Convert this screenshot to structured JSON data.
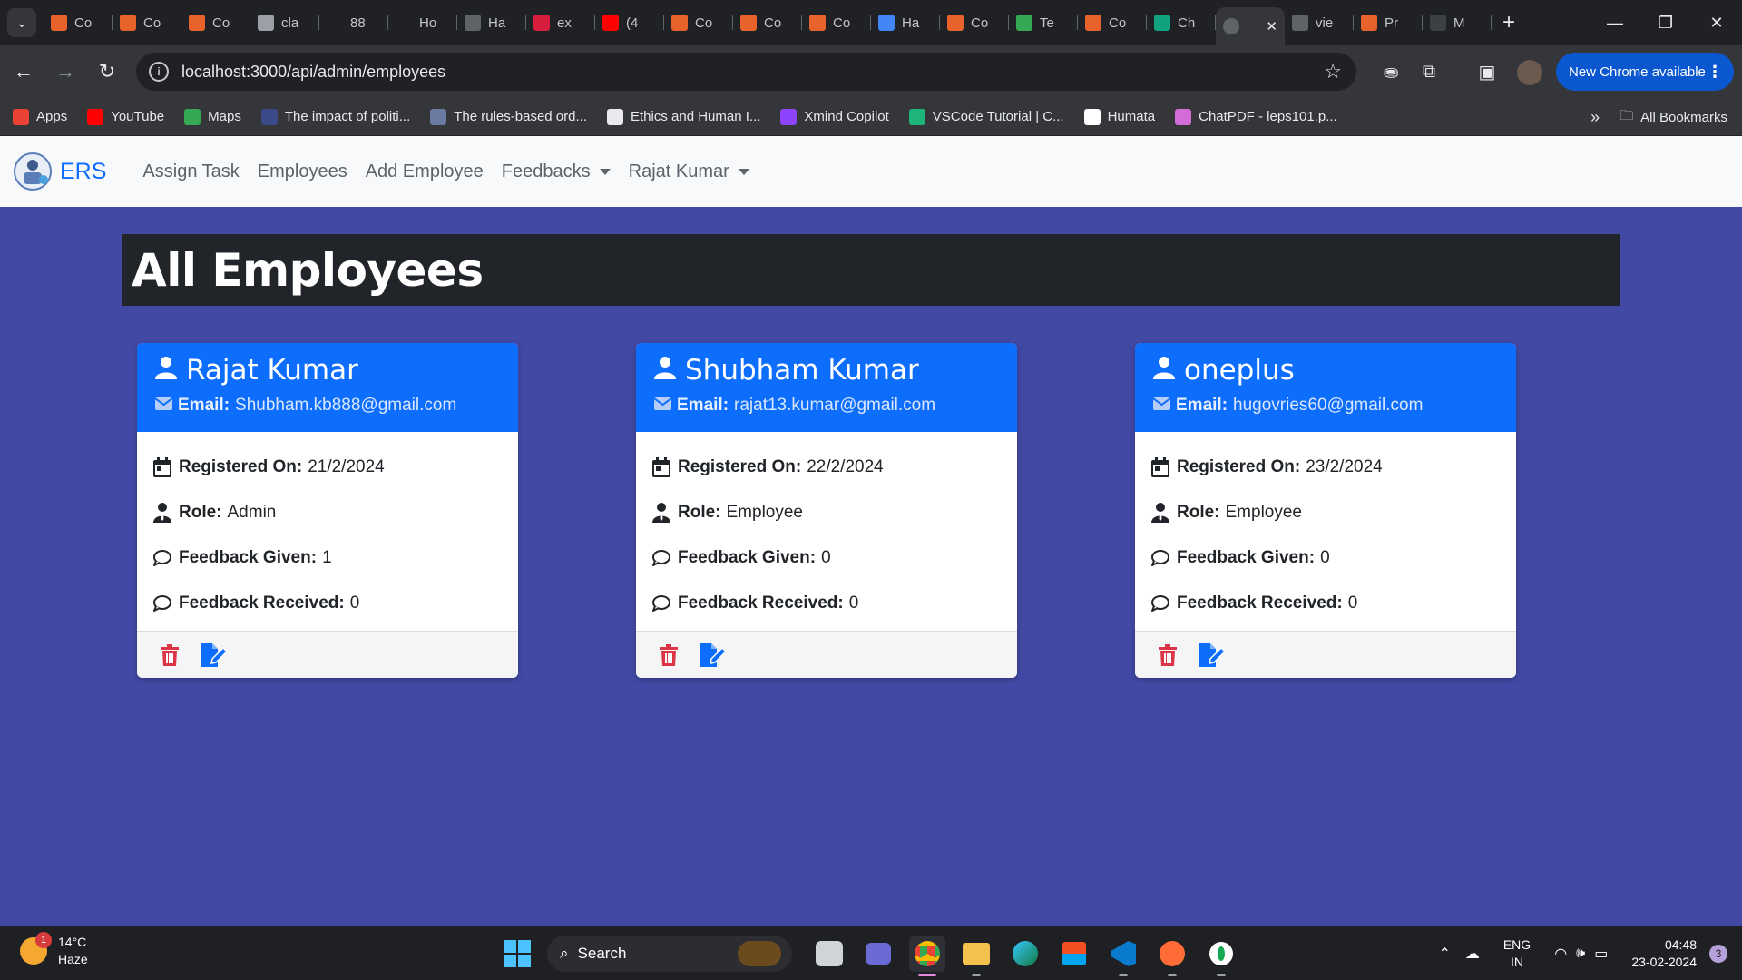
{
  "browser": {
    "tabs": [
      {
        "title": "Co",
        "color": "#e8632b"
      },
      {
        "title": "Co",
        "color": "#e8632b"
      },
      {
        "title": "Co",
        "color": "#e8632b"
      },
      {
        "title": "cla",
        "color": "#9aa0a6"
      },
      {
        "title": "88",
        "color": "#202124"
      },
      {
        "title": "Ho",
        "color": "#202124"
      },
      {
        "title": "Ha",
        "color": "#5f6368"
      },
      {
        "title": "ex",
        "color": "#d61e3c"
      },
      {
        "title": "(4",
        "color": "#ff0000"
      },
      {
        "title": "Co",
        "color": "#e8632b"
      },
      {
        "title": "Co",
        "color": "#e8632b"
      },
      {
        "title": "Co",
        "color": "#e8632b"
      },
      {
        "title": "Ha",
        "color": "#4285f4"
      },
      {
        "title": "Co",
        "color": "#e8632b"
      },
      {
        "title": "Te",
        "color": "#34a853"
      },
      {
        "title": "Co",
        "color": "#e8632b"
      },
      {
        "title": "Ch",
        "color": "#10a37f"
      }
    ],
    "active_tab": {
      "title": ""
    },
    "tabs_after": [
      {
        "title": "vie",
        "color": "#5f6368"
      },
      {
        "title": "Pr",
        "color": "#e8632b"
      },
      {
        "title": "M",
        "color": "#3c4043"
      }
    ],
    "url": "localhost:3000/api/admin/employees",
    "update_label": "New Chrome available",
    "bookmarks": [
      {
        "label": "Apps",
        "color": "#ea4335"
      },
      {
        "label": "YouTube",
        "color": "#ff0000"
      },
      {
        "label": "Maps",
        "color": "#34a853"
      },
      {
        "label": "The impact of politi...",
        "color": "#3c4a8a"
      },
      {
        "label": "The rules-based ord...",
        "color": "#6b7aa1"
      },
      {
        "label": "Ethics and Human I...",
        "color": "#e8eaed"
      },
      {
        "label": "Xmind Copilot",
        "color": "#8e44ff"
      },
      {
        "label": "VSCode Tutorial | C...",
        "color": "#1fb57a"
      },
      {
        "label": "Humata",
        "color": "#ffffff"
      },
      {
        "label": "ChatPDF - leps101.p...",
        "color": "#d36bd8"
      }
    ],
    "all_bookmarks": "All Bookmarks"
  },
  "app": {
    "brand": "ERS",
    "nav": {
      "assign_task": "Assign Task",
      "employees": "Employees",
      "add_employee": "Add Employee",
      "feedbacks": "Feedbacks",
      "user": "Rajat Kumar"
    },
    "page_title": "All Employees",
    "labels": {
      "email": "Email:",
      "registered": "Registered On:",
      "role": "Role:",
      "given": "Feedback Given:",
      "received": "Feedback Received:"
    },
    "employees": [
      {
        "name": "Rajat Kumar",
        "email": "Shubham.kb888@gmail.com",
        "registered": "21/2/2024",
        "role": "Admin",
        "given": "1",
        "received": "0"
      },
      {
        "name": "Shubham Kumar",
        "email": "rajat13.kumar@gmail.com",
        "registered": "22/2/2024",
        "role": "Employee",
        "given": "0",
        "received": "0"
      },
      {
        "name": "oneplus",
        "email": "hugovries60@gmail.com",
        "registered": "23/2/2024",
        "role": "Employee",
        "given": "0",
        "received": "0"
      }
    ]
  },
  "taskbar": {
    "temp": "14°C",
    "weather": "Haze",
    "weather_badge": "1",
    "search": "Search",
    "lang_top": "ENG",
    "lang_bottom": "IN",
    "time": "04:48",
    "date": "23-02-2024",
    "notifications": "3"
  },
  "colors": {
    "page_bg": "#4249a4",
    "card_header": "#0d6efd",
    "delete": "#dc3545",
    "edit": "#0d6efd"
  }
}
